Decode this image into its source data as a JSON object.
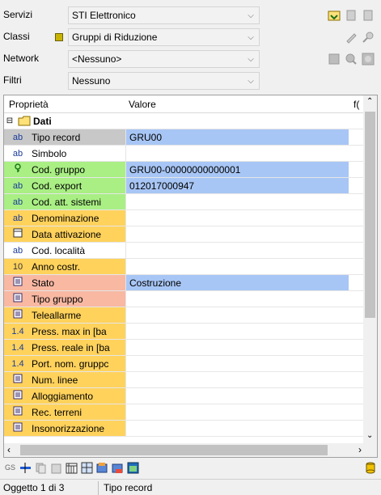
{
  "form": {
    "servizi": {
      "label": "Servizi",
      "value": "STI Elettronico"
    },
    "classi": {
      "label": "Classi",
      "value": "Gruppi di Riduzione"
    },
    "network": {
      "label": "Network",
      "value": "<Nessuno>"
    },
    "filtri": {
      "label": "Filtri",
      "value": "Nessuno"
    }
  },
  "grid": {
    "headers": [
      "Proprietà",
      "Valore",
      "f("
    ],
    "group": "Dati",
    "rows": [
      {
        "name": "Tipo record",
        "value": "GRU00",
        "bg": "#c8c8c8",
        "icon": "ab",
        "selected": true
      },
      {
        "name": "Simbolo",
        "value": "",
        "bg": "#ffffff",
        "icon": "ab",
        "selected": false
      },
      {
        "name": "Cod. gruppo",
        "value": "GRU00-00000000000001",
        "bg": "#a9ef84",
        "icon": "key",
        "selected": true
      },
      {
        "name": "Cod. export",
        "value": "012017000947",
        "bg": "#a9ef84",
        "icon": "ab",
        "selected": true
      },
      {
        "name": "Cod. att. sistemi",
        "value": "",
        "bg": "#a9ef84",
        "icon": "ab",
        "selected": false
      },
      {
        "name": "Denominazione",
        "value": "",
        "bg": "#ffd25c",
        "icon": "ab",
        "selected": false
      },
      {
        "name": "Data attivazione",
        "value": "",
        "bg": "#ffd25c",
        "icon": "cal",
        "selected": false
      },
      {
        "name": "Cod. località",
        "value": "",
        "bg": "#ffffff",
        "icon": "ab",
        "selected": false
      },
      {
        "name": "Anno costr.",
        "value": "",
        "bg": "#ffd25c",
        "icon": "10",
        "selected": false
      },
      {
        "name": "Stato",
        "value": "Costruzione",
        "bg": "#f8b8a2",
        "icon": "list",
        "selected": true
      },
      {
        "name": "Tipo gruppo",
        "value": "",
        "bg": "#f8b8a2",
        "icon": "list",
        "selected": false
      },
      {
        "name": "Teleallarme",
        "value": "",
        "bg": "#ffd25c",
        "icon": "list",
        "selected": false
      },
      {
        "name": "Press. max in [ba",
        "value": "",
        "bg": "#ffd25c",
        "icon": "1.4",
        "selected": false
      },
      {
        "name": "Press. reale in [ba",
        "value": "",
        "bg": "#ffd25c",
        "icon": "1.4",
        "selected": false
      },
      {
        "name": "Port. nom. gruppc",
        "value": "",
        "bg": "#ffd25c",
        "icon": "1.4",
        "selected": false
      },
      {
        "name": "Num. linee",
        "value": "",
        "bg": "#ffd25c",
        "icon": "list",
        "selected": false
      },
      {
        "name": "Alloggiamento",
        "value": "",
        "bg": "#ffd25c",
        "icon": "list",
        "selected": false
      },
      {
        "name": "Rec. terreni",
        "value": "",
        "bg": "#ffd25c",
        "icon": "list",
        "selected": false
      },
      {
        "name": "Insonorizzazione",
        "value": "",
        "bg": "#ffd25c",
        "icon": "list",
        "selected": false
      }
    ]
  },
  "toolbar": {
    "gs": "GS"
  },
  "status": {
    "left": "Oggetto 1 di 3",
    "right": "Tipo record"
  },
  "icons": {
    "ab": "ab",
    "key": "⚷",
    "cal": "▦",
    "10": "10",
    "list": "▤",
    "1.4": "1.4"
  }
}
